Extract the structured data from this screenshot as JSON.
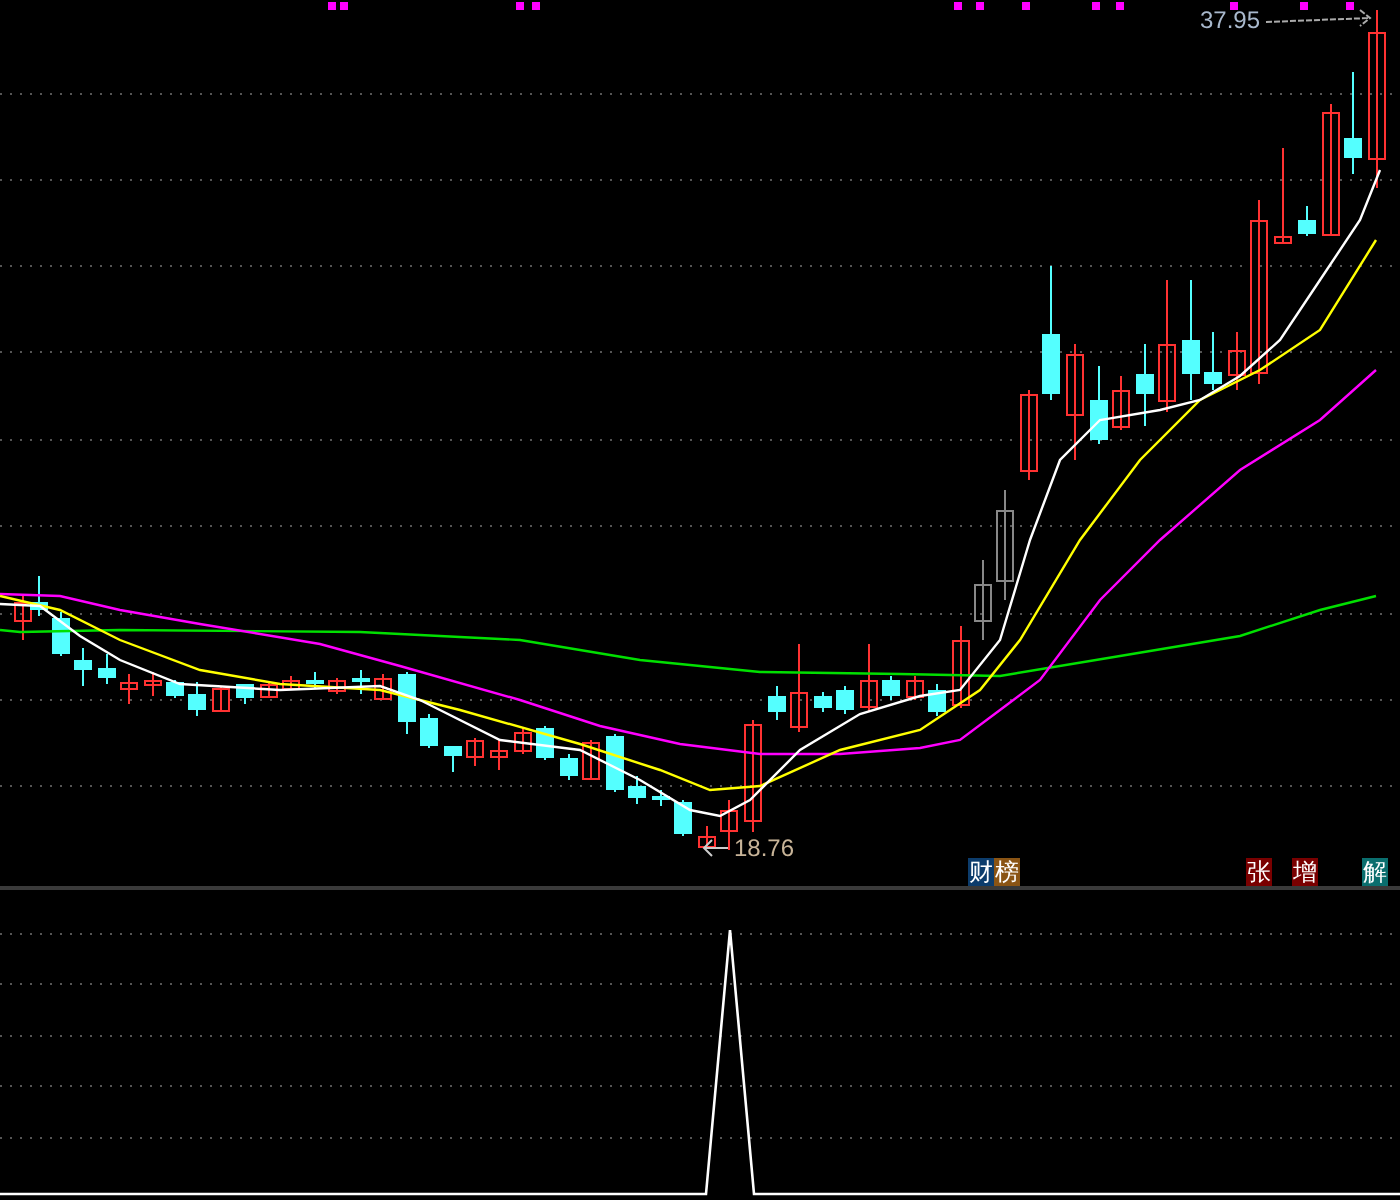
{
  "price_chart": {
    "high_label": "37.95",
    "low_label": "18.76",
    "badges": [
      {
        "text": "财",
        "color": "#0c3c6c"
      },
      {
        "text": "榜",
        "color": "#8a5414"
      },
      {
        "text": "张",
        "color": "#7a0000"
      },
      {
        "text": "增",
        "color": "#7a0000"
      },
      {
        "text": "解",
        "color": "#0a6e6e"
      }
    ]
  }
}
